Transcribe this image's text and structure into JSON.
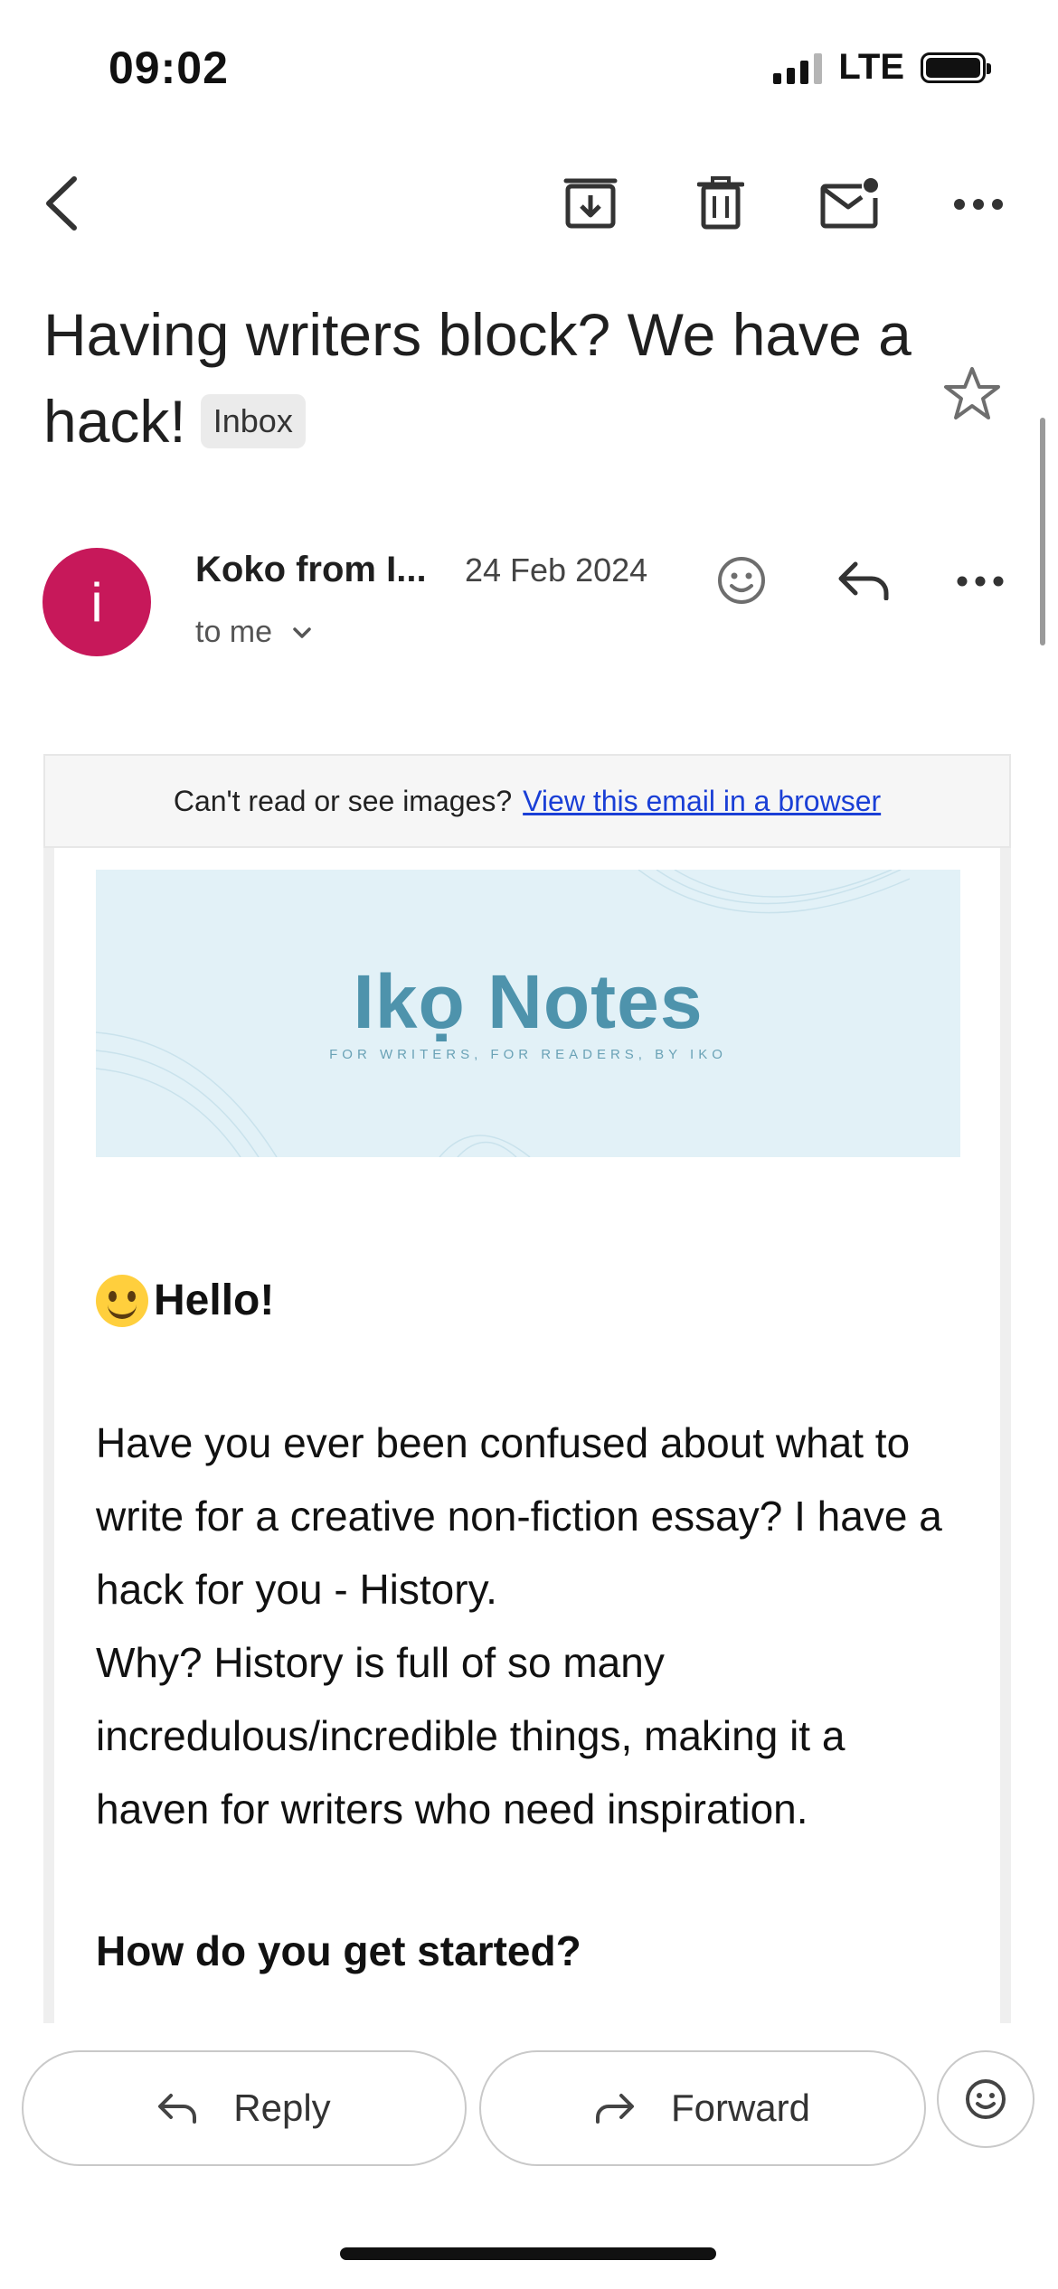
{
  "status_bar": {
    "time": "09:02",
    "network": "LTE"
  },
  "toolbar": {
    "back_icon": "chevron-left-icon",
    "actions": [
      "archive-icon",
      "trash-icon",
      "mark-unread-icon",
      "more-icon"
    ]
  },
  "email": {
    "subject": "Having writers block? We have a hack!",
    "label": "Inbox",
    "sender": {
      "avatar_letter": "i",
      "avatar_color": "#c7185a",
      "name": "Koko from I...",
      "date": "24 Feb 2024",
      "recipient": "to me"
    }
  },
  "body": {
    "cant_read_text": "Can't read or see images?",
    "view_in_browser_link": "View this email in a browser",
    "logo": {
      "title": "Ikọ Notes",
      "tagline": "FOR WRITERS, FOR READERS, BY IKO"
    },
    "greeting": "Hello!",
    "paragraph1": "Have you ever been confused about what to write for a creative non-fiction essay? I have a hack for you - History.",
    "paragraph2": "Why? History is full of so many incredulous/incredible things, making it a haven for writers who need inspiration.",
    "subheading": "How do you get started?"
  },
  "actions": {
    "reply_label": "Reply",
    "forward_label": "Forward"
  },
  "colors": {
    "accent_link": "#1a3fd6",
    "logo_bg": "#e2f1f7",
    "logo_text": "#4e93ac"
  }
}
